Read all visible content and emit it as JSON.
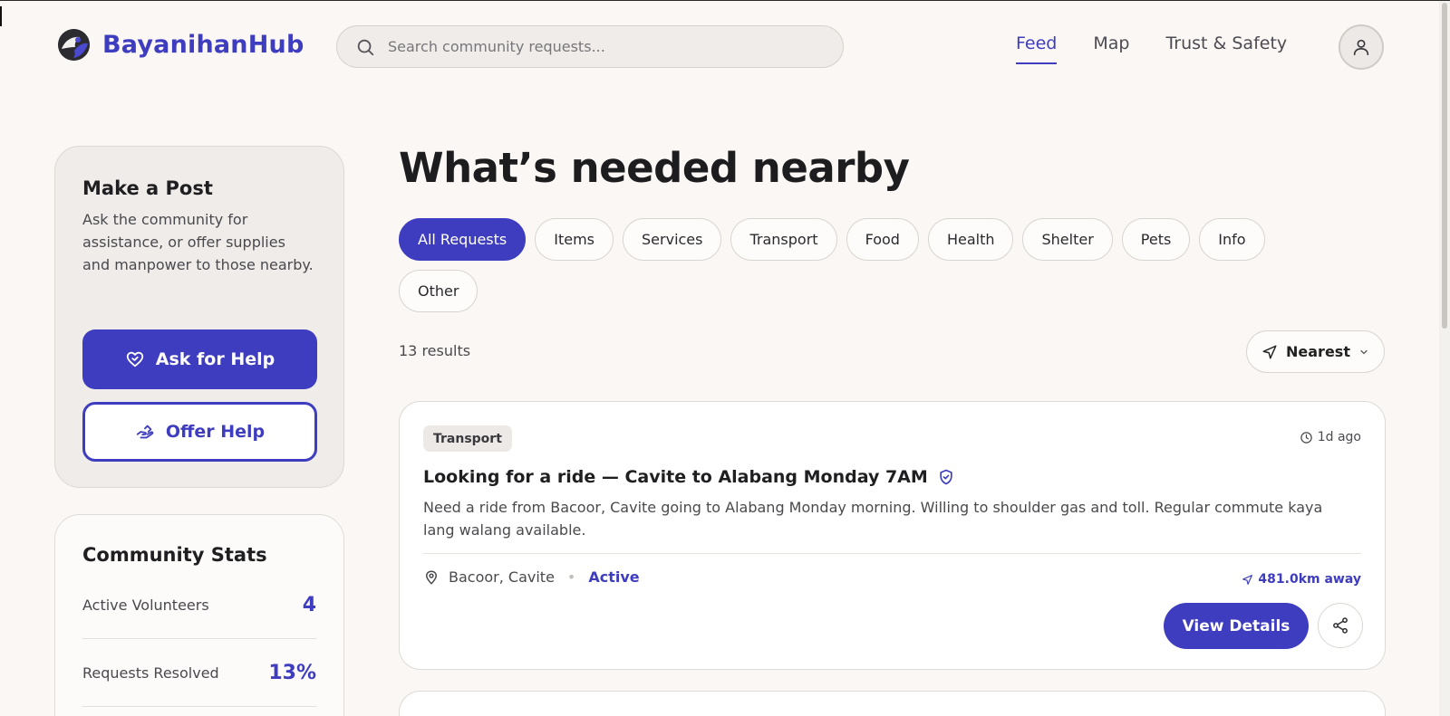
{
  "header": {
    "brand_name": "BayanihanHub",
    "search_placeholder": "Search community requests...",
    "nav": [
      {
        "label": "Feed",
        "active": true
      },
      {
        "label": "Map",
        "active": false
      },
      {
        "label": "Trust & Safety",
        "active": false
      }
    ],
    "avatar_icon": "user-icon"
  },
  "make_post": {
    "title": "Make a Post",
    "description": "Ask the community for assistance, or offer supplies and manpower to those nearby.",
    "ask_label": "Ask for Help",
    "offer_label": "Offer Help"
  },
  "stats": {
    "title": "Community Stats",
    "rows": [
      {
        "label": "Active Volunteers",
        "value": "4"
      },
      {
        "label": "Requests Resolved",
        "value": "13%"
      }
    ]
  },
  "main": {
    "title": "What’s needed nearby",
    "chips": [
      "All Requests",
      "Items",
      "Services",
      "Transport",
      "Food",
      "Health",
      "Shelter",
      "Pets",
      "Info",
      "Other"
    ],
    "active_chip": "All Requests",
    "results_text": "13 results",
    "sort_label": "Nearest"
  },
  "cards": [
    {
      "tag": "Transport",
      "time": "1d ago",
      "title": "Looking for a ride — Cavite to Alabang Monday 7AM",
      "verified": true,
      "description": "Need a ride from Bacoor, Cavite going to Alabang Monday morning. Willing to shoulder gas and toll. Regular commute kaya lang walang available.",
      "location": "Bacoor, Cavite",
      "status": "Active",
      "distance": "481.0km away",
      "view_label": "View Details"
    }
  ],
  "colors": {
    "accent": "#3f3dbf",
    "background": "#faf7f4"
  }
}
